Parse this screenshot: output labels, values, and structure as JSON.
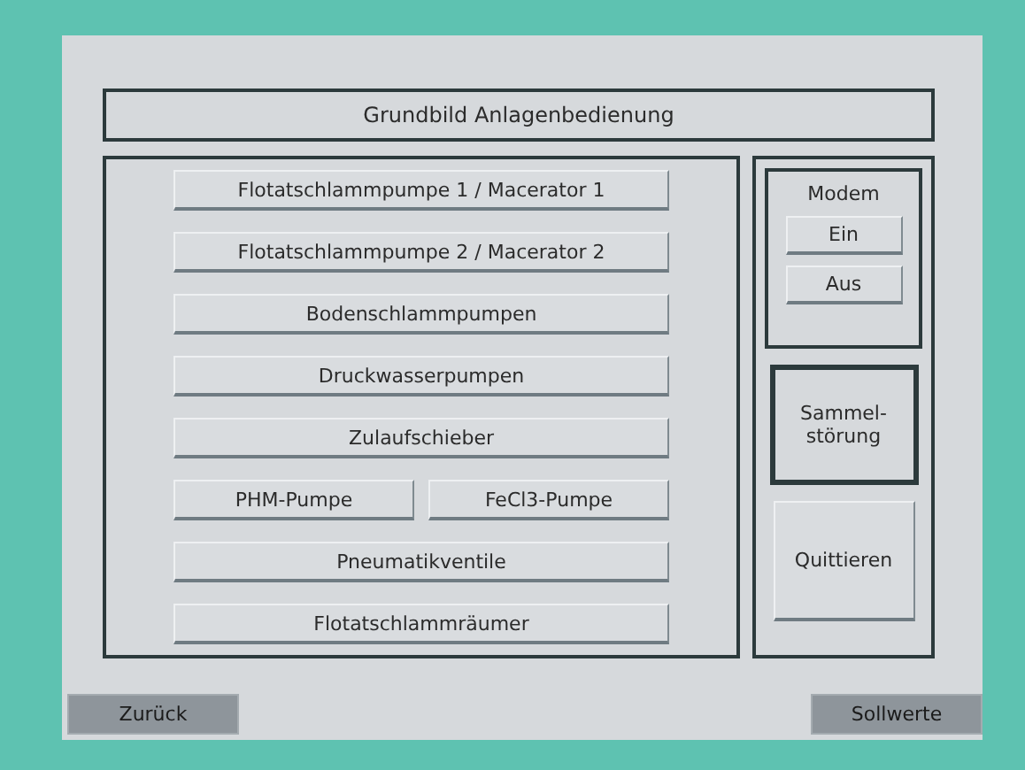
{
  "title": "Grundbild Anlagenbedienung",
  "menu_rows": [
    [
      "Flotatschlammpumpe 1 / Macerator 1"
    ],
    [
      "Flotatschlammpumpe 2 / Macerator 2"
    ],
    [
      "Bodenschlammpumpen"
    ],
    [
      "Druckwasserpumpen"
    ],
    [
      "Zulaufschieber"
    ],
    [
      "PHM-Pumpe",
      "FeCl3-Pumpe"
    ],
    [
      "Pneumatikventile"
    ],
    [
      "Flotatschlammräumer"
    ]
  ],
  "modem": {
    "label": "Modem",
    "buttons": [
      "Ein",
      "Aus"
    ]
  },
  "alarm": {
    "label_lines": [
      "Sammel-",
      "störung"
    ]
  },
  "acknowledge_button": "Quittieren",
  "footer": {
    "left_button": "Zurück",
    "right_button": "Sollwerte"
  }
}
